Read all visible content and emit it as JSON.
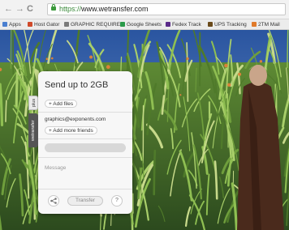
{
  "browser": {
    "url_scheme": "https://",
    "url_host": "www.wetransfer.com",
    "bookmarks": [
      {
        "label": "Apps",
        "color": "#4a7fd0"
      },
      {
        "label": "Host Gator",
        "color": "#d04a2a"
      },
      {
        "label": "GRAPHIC REQUIREM",
        "color": "#7a7a7a"
      },
      {
        "label": "Google Sheets",
        "color": "#2a9a4a"
      },
      {
        "label": "Fedex Track",
        "color": "#5a2a8a"
      },
      {
        "label": "UPS Tracking",
        "color": "#6a4a1a"
      },
      {
        "label": "2TM Mail",
        "color": "#e07a2a"
      }
    ]
  },
  "panel": {
    "title": "Send up to 2GB",
    "add_files": "+ Add files",
    "email": "graphics@exponents.com",
    "add_friends": "+ Add more friends",
    "message_placeholder": "Message",
    "transfer_label": "Transfer",
    "help_label": "?",
    "side_plus": "plus",
    "side_brand": "wetransfer"
  },
  "colors": {
    "sky": "#2f5fa8",
    "grass_dark": "#2f5a22",
    "grass_light": "#7fae4a",
    "coat": "#4a2a1c"
  }
}
